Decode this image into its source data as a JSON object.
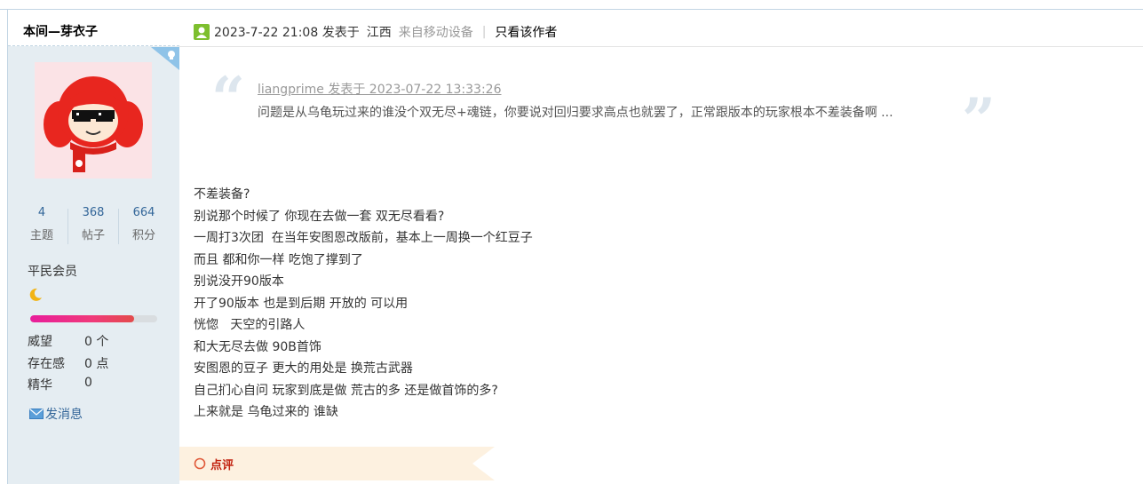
{
  "sidebar": {
    "username": "本间—芽衣子",
    "stats": [
      {
        "value": "4",
        "label": "主题"
      },
      {
        "value": "368",
        "label": "帖子"
      },
      {
        "value": "664",
        "label": "积分"
      }
    ],
    "rank": "平民会员",
    "level_progress": 0.82,
    "fields": [
      {
        "label": "威望",
        "value": "0 个"
      },
      {
        "label": "存在感",
        "value": "0 点"
      },
      {
        "label": "精华",
        "value": "0"
      }
    ],
    "message_link": "发消息"
  },
  "post": {
    "date": "2023-7-22 21:08 发表于",
    "location": "江西",
    "source": "来自移动设备",
    "separator": "|",
    "only_author": "只看该作者"
  },
  "quote": {
    "author_line": "liangprime 发表于 2023-07-22 13:33:26",
    "text": "问题是从乌龟玩过来的谁没个双无尽+魂链，你要说对回归要求高点也就罢了，正常跟版本的玩家根本不差装备啊 ..."
  },
  "content": {
    "lines": [
      "不差装备?",
      "别说那个时候了 你现在去做一套 双无尽看看?",
      "一周打3次团  在当年安图恩改版前，基本上一周换一个红豆子",
      "而且 都和你一样 吃饱了撑到了",
      "别说没开90版本",
      "开了90版本 也是到后期 开放的 可以用",
      "恍惚   天空的引路人",
      "和大无尽去做 90B首饰",
      "安图恩的豆子 更大的用处是 换荒古武器",
      "自己扪心自问 玩家到底是做 荒古的多 还是做首饰的多?",
      "上来就是 乌龟过来的 谁缺"
    ]
  },
  "rate": {
    "label": "点评"
  },
  "colors": {
    "sidebar_bg": "#e5edf2",
    "link": "#336699",
    "rate_label": "#c2220f",
    "rate_bg": "#fdf1e0"
  }
}
